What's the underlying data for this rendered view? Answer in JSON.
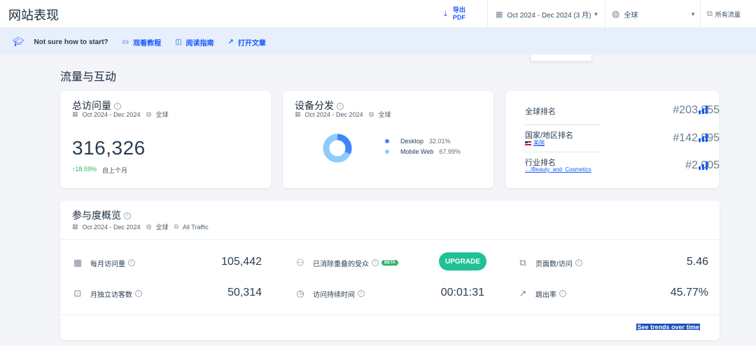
{
  "header": {
    "title": "网站表现",
    "export_line1": "导出",
    "export_line2": "PDF",
    "date_range": "Oct 2024 - Dec 2024 (3 月)",
    "region": "全球",
    "traffic": "所有流量"
  },
  "helpbar": {
    "question": "Not sure how to start?",
    "links": [
      "观看教程",
      "阅读指南",
      "打开文章"
    ]
  },
  "section_title": "流量与互动",
  "visits_card": {
    "title": "总访问量",
    "date": "Oct 2024 - Dec 2024",
    "region": "全球",
    "value": "316,326",
    "change": "↑18.59%",
    "compare": "自上个月"
  },
  "device_card": {
    "title": "设备分发",
    "date": "Oct 2024 - Dec 2024",
    "region": "全球",
    "colors": {
      "desktop": "#3e86f7",
      "mobile": "#8fcbfb"
    },
    "items": [
      {
        "label": "Desktop",
        "pct": "32.01%",
        "value": 32.01
      },
      {
        "label": "Mobile Web",
        "pct": "67.99%",
        "value": 67.99
      }
    ]
  },
  "rank_card": {
    "rows": [
      {
        "label": "全球排名",
        "sub": "",
        "value": "#203,855"
      },
      {
        "label": "国家/地区排名",
        "sub": "美国",
        "value": "#142,895"
      },
      {
        "label": "行业排名",
        "sub": "…/Beauty_and_Cosmetics",
        "value": "#2,005"
      }
    ]
  },
  "engagement": {
    "title": "参与度概览",
    "date": "Oct 2024 - Dec 2024",
    "region": "全球",
    "traffic": "All Traffic",
    "metrics": [
      {
        "label": "每月访问量",
        "value": "105,442"
      },
      {
        "label": "月独立访客数",
        "value": "50,314"
      },
      {
        "label": "已消除重叠的受众",
        "badge": "BETA",
        "button": "UPGRADE"
      },
      {
        "label": "访问持续时间",
        "value": "00:01:31"
      },
      {
        "label": "页面数/访问",
        "value": "5.46"
      },
      {
        "label": "跳出率",
        "value": "45.77%"
      }
    ],
    "trends_link": "See trends over time"
  }
}
